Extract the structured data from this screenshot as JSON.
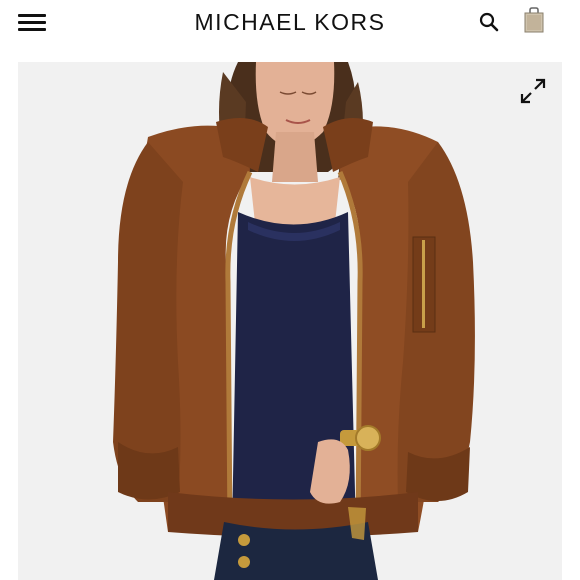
{
  "header": {
    "brand": "MICHAEL KORS",
    "icons": {
      "menu": "hamburger-menu-icon",
      "search": "search-icon",
      "bag": "shopping-bag-icon"
    }
  },
  "product_image": {
    "icons": {
      "expand": "expand-icon"
    },
    "colors": {
      "background": "#f1f1f1",
      "jacket": "#8b4a22",
      "top": "#1f2447",
      "denim": "#1c2740",
      "skin": "#e3b196",
      "hair": "#4a2f1c"
    }
  }
}
